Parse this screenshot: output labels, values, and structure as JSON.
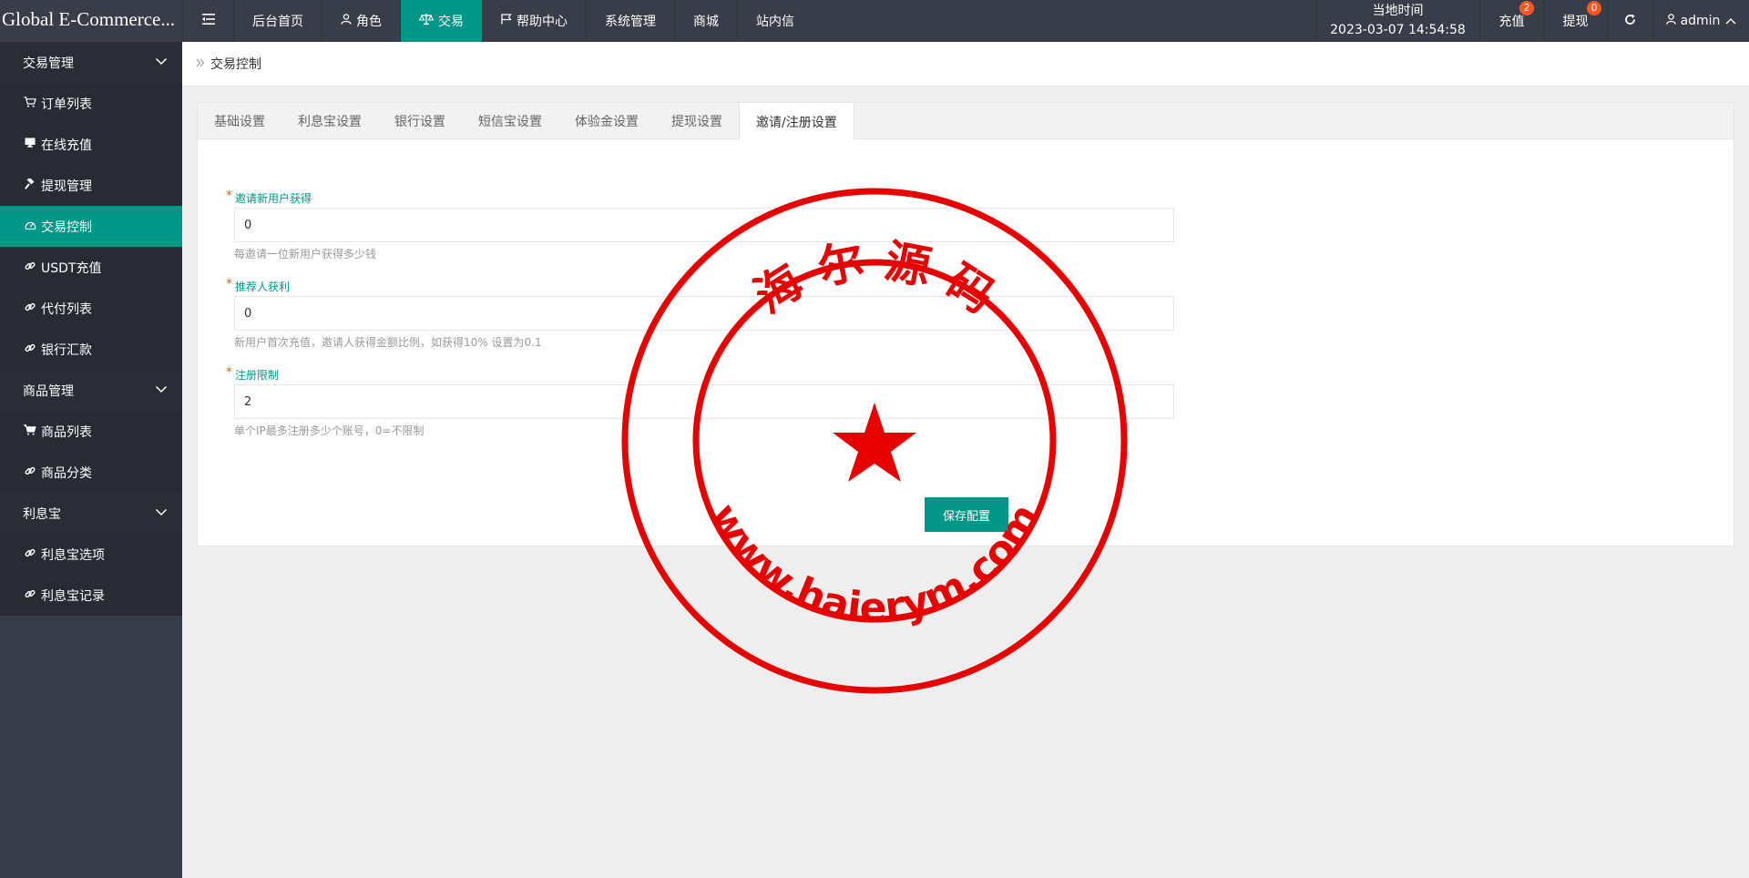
{
  "header": {
    "logo": "Global E-Commerce...",
    "toggle_icon": "menu-icon",
    "nav": [
      {
        "label": "后台首页",
        "icon": ""
      },
      {
        "label": "角色",
        "icon": "user-icon"
      },
      {
        "label": "交易",
        "icon": "scale-icon"
      },
      {
        "label": "帮助中心",
        "icon": "flag-icon"
      },
      {
        "label": "系统管理",
        "icon": ""
      },
      {
        "label": "商城",
        "icon": ""
      },
      {
        "label": "站内信",
        "icon": ""
      }
    ],
    "time_label": "当地时间",
    "time_value": "2023-03-07 14:54:58",
    "recharge_label": "充值",
    "recharge_badge": "2",
    "withdraw_label": "提现",
    "withdraw_badge": "0",
    "refresh_icon": "refresh-icon",
    "user_label": "admin"
  },
  "sidebar": {
    "groups": [
      {
        "label": "交易管理",
        "items": [
          {
            "label": "订单列表",
            "icon": "cart-icon"
          },
          {
            "label": "在线充值",
            "icon": "monitor-icon"
          },
          {
            "label": "提现管理",
            "icon": "hammer-icon"
          },
          {
            "label": "交易控制",
            "icon": "dashboard-icon"
          },
          {
            "label": "USDT充值",
            "icon": "link-icon"
          },
          {
            "label": "代付列表",
            "icon": "link-icon"
          },
          {
            "label": "银行汇款",
            "icon": "link-icon"
          }
        ]
      },
      {
        "label": "商品管理",
        "items": [
          {
            "label": "商品列表",
            "icon": "cart-icon"
          },
          {
            "label": "商品分类",
            "icon": "link-icon"
          }
        ]
      },
      {
        "label": "利息宝",
        "items": [
          {
            "label": "利息宝选项",
            "icon": "link-icon"
          },
          {
            "label": "利息宝记录",
            "icon": "link-icon"
          }
        ]
      }
    ]
  },
  "breadcrumb": "交易控制",
  "tabs": [
    "基础设置",
    "利息宝设置",
    "银行设置",
    "短信宝设置",
    "体验金设置",
    "提现设置",
    "邀请/注册设置"
  ],
  "active_tab": 6,
  "form": {
    "fields": [
      {
        "label": "邀请新用户获得",
        "value": "0",
        "help": "每邀请一位新用户获得多少钱"
      },
      {
        "label": "推荐人获利",
        "value": "0",
        "help": "新用户首次充值，邀请人获得金额比例，如获得10% 设置为0.1"
      },
      {
        "label": "注册限制",
        "value": "2",
        "help": "单个IP最多注册多少个账号，0=不限制"
      }
    ],
    "save_label": "保存配置"
  },
  "seal": {
    "top_text": "海 尔 源 码",
    "bottom_text": "www.haierym.com",
    "color": "#e60000"
  }
}
